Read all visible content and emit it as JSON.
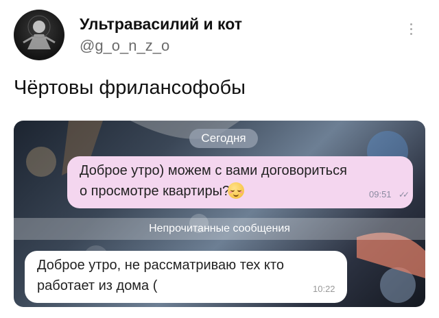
{
  "author": {
    "name": "Ультравасилий и кот",
    "handle": "@g_o_n_z_o"
  },
  "tweet": {
    "text": "Чёртовы фрилансофобы"
  },
  "chat": {
    "date_label": "Сегодня",
    "outgoing": {
      "line1": "Доброе утро) можем с вами договориться",
      "line2": "о просмотре квартиры?",
      "emoji": "relieved-face",
      "time": "09:51",
      "status": "read"
    },
    "unread_label": "Непрочитанные сообщения",
    "incoming": {
      "line1": "Доброе утро, не рассматриваю тех кто",
      "line2": "работает из дома (",
      "time": "10:22"
    }
  }
}
